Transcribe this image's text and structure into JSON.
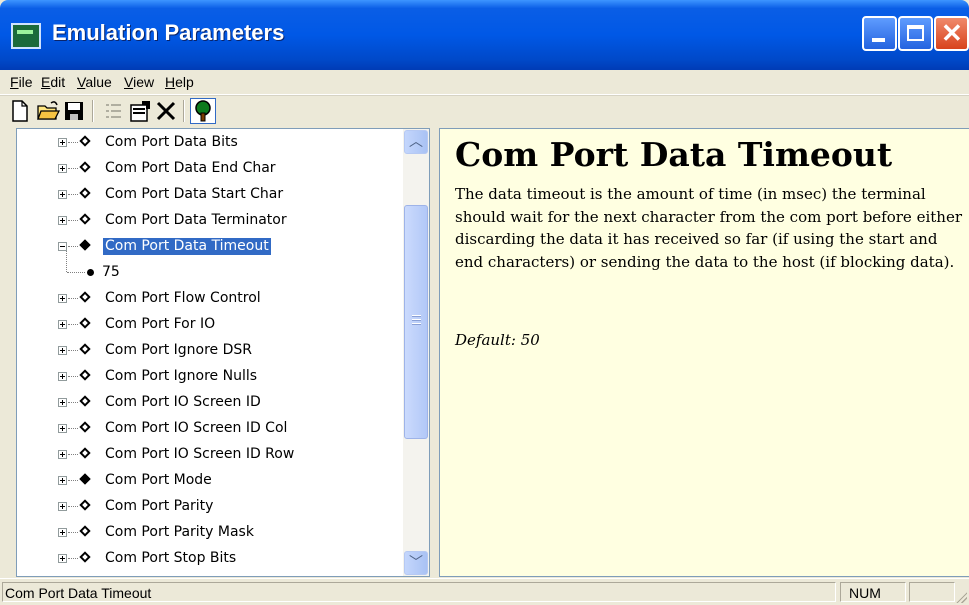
{
  "window": {
    "title": "Emulation Parameters"
  },
  "menu": [
    {
      "pre": "",
      "u": "F",
      "post": "ile"
    },
    {
      "pre": "",
      "u": "E",
      "post": "dit"
    },
    {
      "pre": "",
      "u": "V",
      "post": "alue"
    },
    {
      "pre": "",
      "u": "V",
      "post": "iew"
    },
    {
      "pre": "",
      "u": "H",
      "post": "elp"
    }
  ],
  "toolbar": [
    "new-file-icon",
    "open-folder-icon",
    "save-icon",
    "list-icon",
    "properties-icon",
    "delete-icon",
    "tree-icon"
  ],
  "tree": {
    "items": [
      {
        "label": "Com Port Data Bits",
        "expanded": false,
        "filled": false
      },
      {
        "label": "Com Port Data End Char",
        "expanded": false,
        "filled": false
      },
      {
        "label": "Com Port Data Start Char",
        "expanded": false,
        "filled": false
      },
      {
        "label": "Com Port Data Terminator",
        "expanded": false,
        "filled": false
      },
      {
        "label": "Com Port Data Timeout",
        "expanded": true,
        "filled": true,
        "selected": true
      },
      {
        "label": "75",
        "child": true
      },
      {
        "label": "Com Port Flow Control",
        "expanded": false,
        "filled": false
      },
      {
        "label": "Com Port For IO",
        "expanded": false,
        "filled": false
      },
      {
        "label": "Com Port Ignore DSR",
        "expanded": false,
        "filled": false
      },
      {
        "label": "Com Port Ignore Nulls",
        "expanded": false,
        "filled": false
      },
      {
        "label": "Com Port IO Screen ID",
        "expanded": false,
        "filled": false
      },
      {
        "label": "Com Port IO Screen ID Col",
        "expanded": false,
        "filled": false
      },
      {
        "label": "Com Port IO Screen ID Row",
        "expanded": false,
        "filled": false
      },
      {
        "label": "Com Port Mode",
        "expanded": false,
        "filled": true
      },
      {
        "label": "Com Port Parity",
        "expanded": false,
        "filled": false
      },
      {
        "label": "Com Port Parity Mask",
        "expanded": false,
        "filled": false
      },
      {
        "label": "Com Port Stop Bits",
        "expanded": false,
        "filled": false
      }
    ]
  },
  "help": {
    "title": "Com Port Data Timeout",
    "body": "The data timeout is the amount of time (in msec) the terminal should wait for the next character from the com port before either discarding the data it has received so far (if using the start and end characters) or sending the data to the host (if blocking data).",
    "default": "Default: 50"
  },
  "status": {
    "text": "Com Port Data Timeout",
    "num": "NUM"
  },
  "colors": {
    "selection": "#316ac5",
    "help_bg": "#ffffe1",
    "titlebar": "#0058e6"
  }
}
